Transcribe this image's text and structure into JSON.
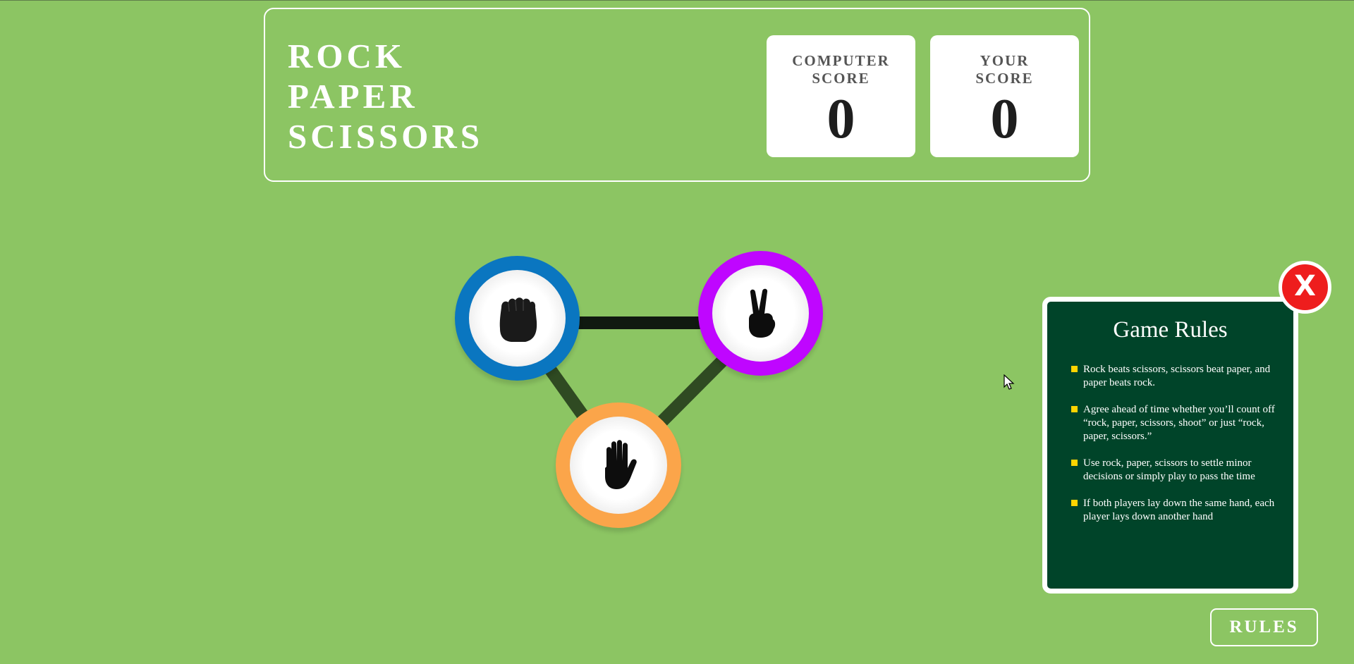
{
  "game": {
    "title_lines": [
      "ROCK",
      "PAPER",
      "SCISSORS"
    ]
  },
  "scores": {
    "computer": {
      "label_line1": "COMPUTER",
      "label_line2": "SCORE",
      "value": "0"
    },
    "you": {
      "label_line1": "YOUR",
      "label_line2": "SCORE",
      "value": "0"
    }
  },
  "choices": [
    {
      "name": "rock",
      "icon": "fist-icon",
      "ring_color": "#0a76c0"
    },
    {
      "name": "scissors",
      "icon": "peace-hand-icon",
      "ring_color": "#bf06ff"
    },
    {
      "name": "paper",
      "icon": "open-hand-icon",
      "ring_color": "#fba54a"
    }
  ],
  "rules_panel": {
    "title": "Game Rules",
    "items": [
      "Rock beats scissors, scissors beat paper, and paper beats rock.",
      "Agree ahead of time whether you’ll count off “rock, paper, scissors, shoot” or just “rock, paper, scissors.”",
      "Use rock, paper, scissors to settle minor decisions or simply play to pass the time",
      "If both players lay down the same hand, each player lays down another hand"
    ],
    "close_label": "X"
  },
  "rules_button": {
    "label": "RULES"
  },
  "colors": {
    "background": "#8cc563",
    "panel": "#004429",
    "close": "#ee1d1d",
    "bullet": "#ffd400"
  }
}
